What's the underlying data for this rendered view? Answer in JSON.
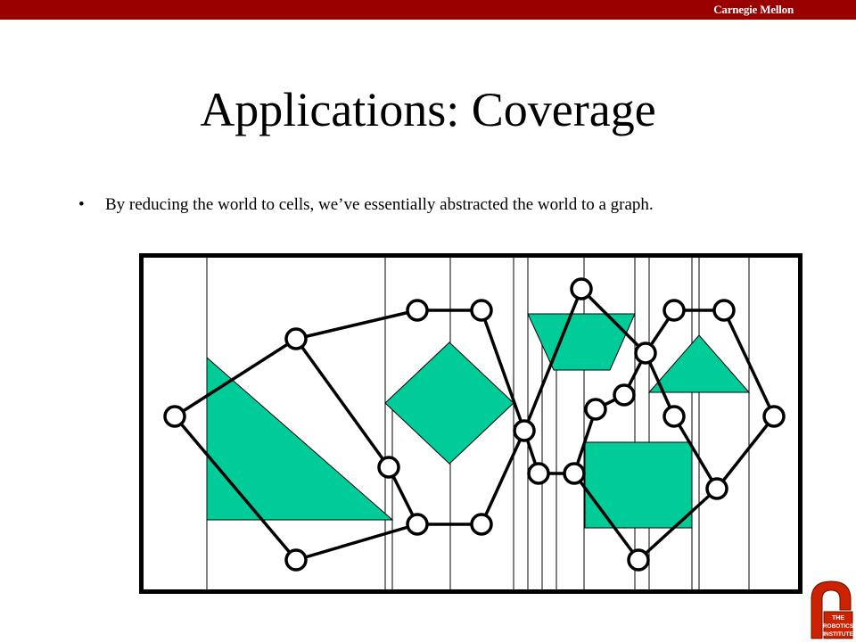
{
  "header": {
    "brand": "Carnegie Mellon"
  },
  "slide": {
    "title": "Applications: Coverage",
    "bullet": "By reducing the world to cells, we’ve essentially abstracted the world to a graph."
  },
  "logo": {
    "lines": [
      "THE",
      "ROBOTICS",
      "INSTITUTE"
    ]
  },
  "colors": {
    "header_bar": "#990000",
    "obstacle_fill": "#00CC99",
    "edge": "#000000"
  }
}
